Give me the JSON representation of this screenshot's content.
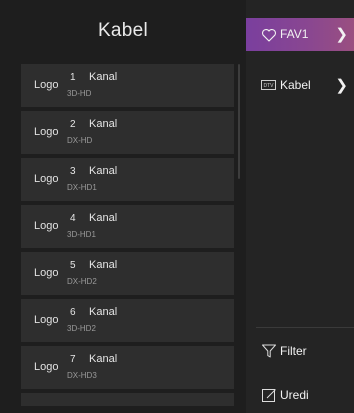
{
  "left_panel": {
    "title": "Kabel",
    "channels": [
      {
        "logo": "Logo",
        "number": "1",
        "name": "Kanal",
        "type": "3D-HD"
      },
      {
        "logo": "Logo",
        "number": "2",
        "name": "Kanal",
        "type": "DX-HD"
      },
      {
        "logo": "Logo",
        "number": "3",
        "name": "Kanal",
        "type": "DX-HD1"
      },
      {
        "logo": "Logo",
        "number": "4",
        "name": "Kanal",
        "type": "3D-HD1"
      },
      {
        "logo": "Logo",
        "number": "5",
        "name": "Kanal",
        "type": "DX-HD2"
      },
      {
        "logo": "Logo",
        "number": "6",
        "name": "Kanal",
        "type": "3D-HD2"
      },
      {
        "logo": "Logo",
        "number": "7",
        "name": "Kanal",
        "type": "DX-HD3"
      }
    ]
  },
  "right_panel": {
    "fav": {
      "label": "FAV1",
      "icon": "heart-icon"
    },
    "source": {
      "label": "Kabel",
      "icon": "dtv-icon",
      "icon_text": "DTV"
    },
    "filter": {
      "label": "Filter",
      "icon": "filter-icon"
    },
    "edit": {
      "label": "Uredi",
      "icon": "edit-icon"
    }
  },
  "colors": {
    "accent_start": "#7a3f9e",
    "accent_end": "#9a4f80",
    "row_bg": "#2e2e2e",
    "panel_bg": "#1e1e1e"
  }
}
